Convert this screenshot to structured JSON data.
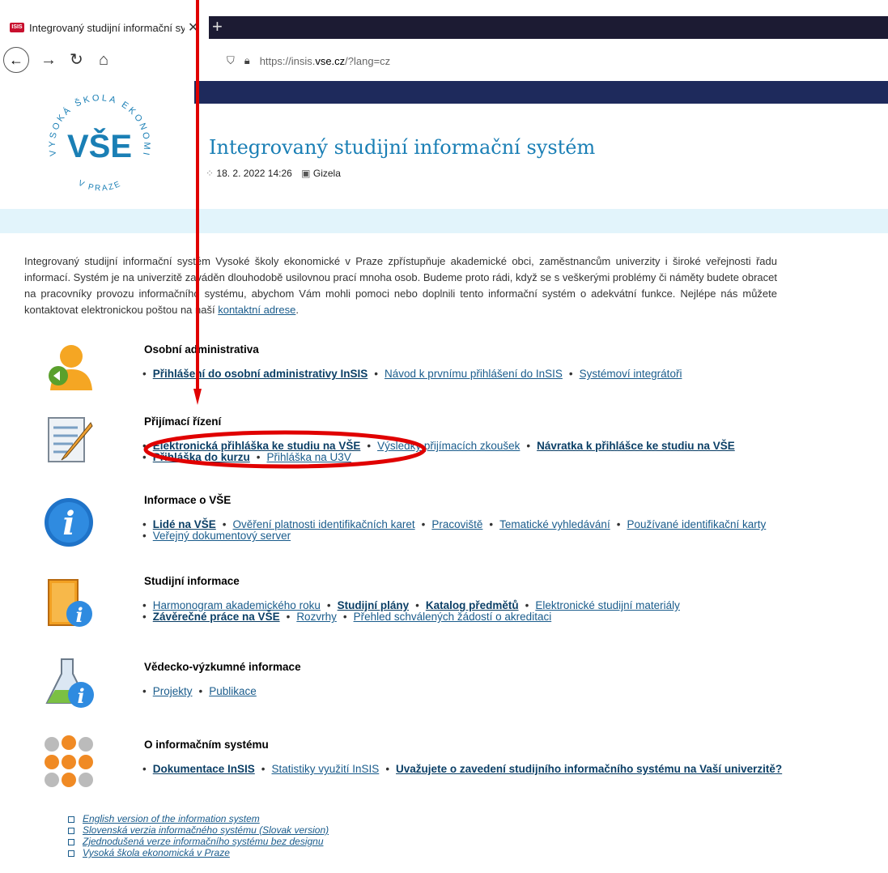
{
  "browser": {
    "tab_title": "Integrovaný studijní informační systém",
    "url_prefix": "https://insis.",
    "url_domain": "vse.cz",
    "url_suffix": "/?lang=cz"
  },
  "header": {
    "logo_text_top": "VYSOKÁ ŠKOLA EKONOMICKÁ",
    "logo_text_bottom": "V PRAZE",
    "logo_mark": "VŠE",
    "system_name": "Integrovaný studijní informační systém",
    "datetime": "18. 2. 2022 14:26",
    "nameday": "Gizela"
  },
  "intro": {
    "text": "Integrovaný studijní informační systém Vysoké školy ekonomické v Praze zpřístupňuje akademické obci, zaměstnancům univerzity i široké veřejnosti řadu informací. Systém je na univerzitě zaváděn dlouhodobě usilovnou prací mnoha osob. Budeme proto rádi, když se s veškerými problémy či náměty budete obracet na pracovníky provozu informačního systému, abychom Vám mohli pomoci nebo doplnili tento informační systém o adekvátní funkce. Nejlépe nás můžete kontaktovat elektronickou poštou na naší",
    "link": "kontaktní adrese",
    "end": "."
  },
  "sections": [
    {
      "title": "Osobní administrativa",
      "icon": "user-icon",
      "rows": [
        [
          {
            "t": "Přihlášení do osobní administrativy InSIS",
            "b": true
          },
          {
            "t": "Návod k prvnímu přihlášení do InSIS"
          },
          {
            "t": "Systémoví integrátoři"
          }
        ]
      ]
    },
    {
      "title": "Přijímací řízení",
      "icon": "form-edit-icon",
      "rows": [
        [
          {
            "t": "Elektronická přihláška ke studiu na VŠE",
            "b": true
          },
          {
            "t": "Výsledky přijímacích zkoušek"
          },
          {
            "t": "Návratka k přihlášce ke studiu na VŠE",
            "b": true
          }
        ],
        [
          {
            "t": "Přihláška do kurzu",
            "b": true
          },
          {
            "t": "Přihláška na U3V"
          }
        ]
      ]
    },
    {
      "title": "Informace o VŠE",
      "icon": "info-icon",
      "rows": [
        [
          {
            "t": "Lidé na VŠE",
            "b": true
          },
          {
            "t": "Ověření platnosti identifikačních karet"
          },
          {
            "t": "Pracoviště"
          },
          {
            "t": "Tematické vyhledávání"
          },
          {
            "t": "Používané identifikační karty"
          }
        ],
        [
          {
            "t": "Veřejný dokumentový server"
          }
        ]
      ]
    },
    {
      "title": "Studijní informace",
      "icon": "study-book-icon",
      "rows": [
        [
          {
            "t": "Harmonogram akademického roku"
          },
          {
            "t": "Studijní plány",
            "b": true
          },
          {
            "t": "Katalog předmětů",
            "b": true
          },
          {
            "t": "Elektronické studijní materiály"
          }
        ],
        [
          {
            "t": "Závěrečné práce na VŠE",
            "b": true
          },
          {
            "t": "Rozvrhy"
          },
          {
            "t": "Přehled schválených žádostí o akreditaci"
          }
        ]
      ]
    },
    {
      "title": "Vědecko-výzkumné informace",
      "icon": "flask-icon",
      "rows": [
        [
          {
            "t": "Projekty"
          },
          {
            "t": "Publikace"
          }
        ]
      ]
    },
    {
      "title": "O informačním systému",
      "icon": "network-icon",
      "rows": [
        [
          {
            "t": "Dokumentace InSIS",
            "b": true
          },
          {
            "t": "Statistiky využití InSIS"
          },
          {
            "t": "Uvažujete o zavedení studijního informačního systému na Vaší univerzitě?",
            "b": true
          }
        ]
      ]
    }
  ],
  "bottom_links": [
    "English version of the information system",
    "Slovenská verzia informačného systému (Slovak version)",
    "Zjednodušená verze informačního systému bez designu",
    "Vysoká škola ekonomická v Praze"
  ],
  "annotation": {
    "arrow_color": "#e00000",
    "ellipse_color": "#e00000"
  }
}
